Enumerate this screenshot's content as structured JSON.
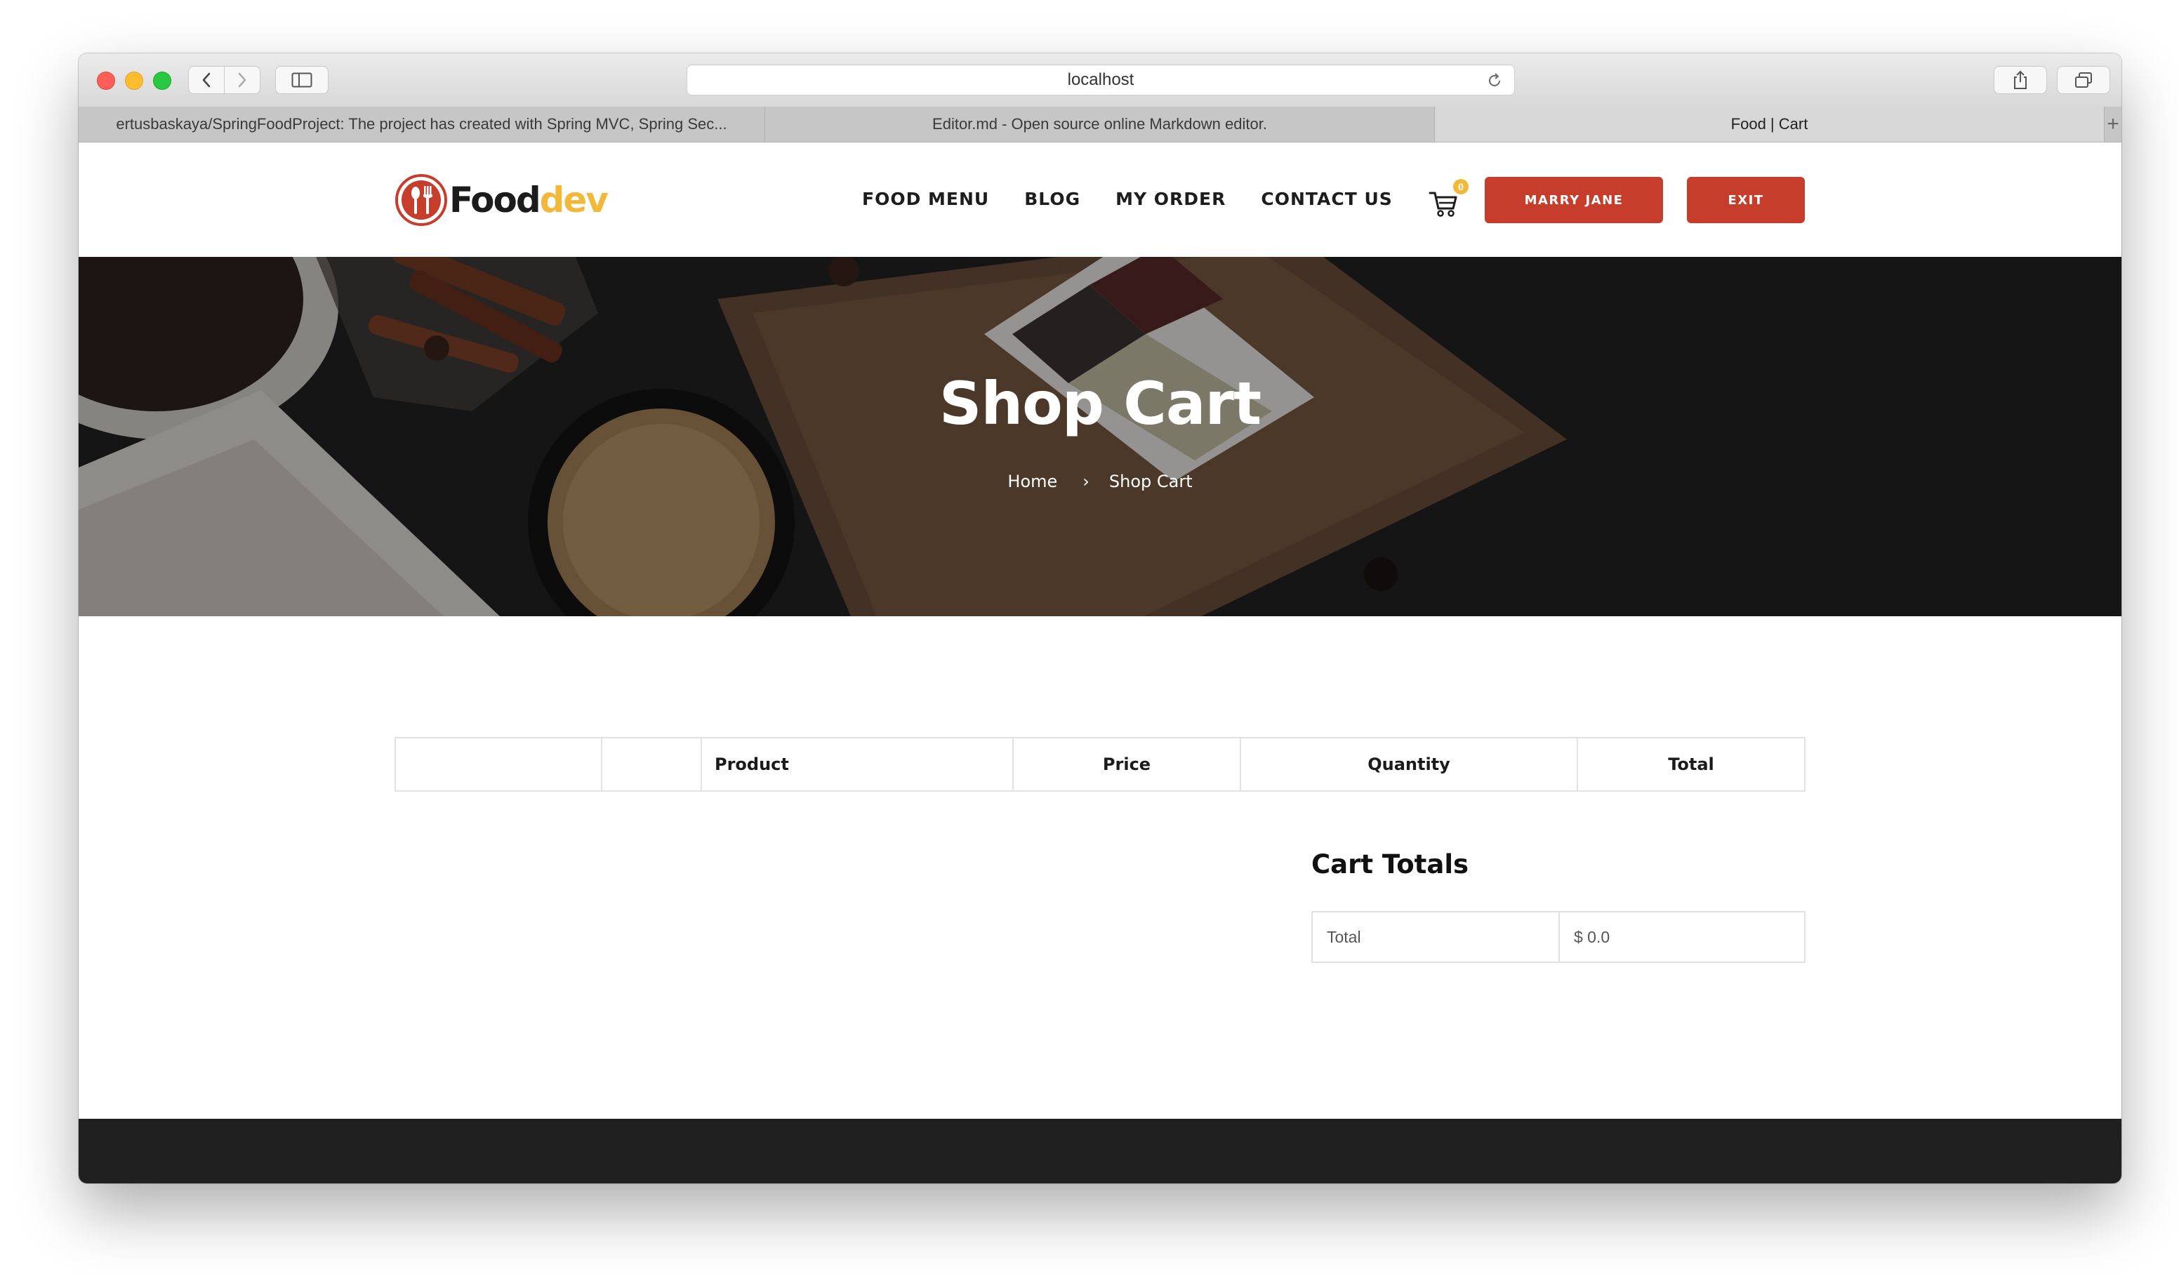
{
  "browser": {
    "url": "localhost",
    "tabs": [
      {
        "title": "ertusbaskaya/SpringFoodProject: The project has created with Spring MVC, Spring Sec..."
      },
      {
        "title": "Editor.md - Open source online Markdown editor."
      },
      {
        "title": "Food | Cart"
      }
    ],
    "active_tab": "Food | Cart"
  },
  "header": {
    "logo_food": "Food",
    "logo_dev": "dev",
    "nav": [
      {
        "label": "FOOD MENU"
      },
      {
        "label": "BLOG"
      },
      {
        "label": "MY ORDER"
      },
      {
        "label": "CONTACT US"
      }
    ],
    "cart_count": "0",
    "user_button": "MARRY JANE",
    "exit_button": "EXIT"
  },
  "hero": {
    "title": "Shop Cart",
    "breadcrumb": [
      "Home",
      "Shop Cart"
    ]
  },
  "cart_table": {
    "columns": [
      "",
      "",
      "Product",
      "Price",
      "Quantity",
      "Total"
    ],
    "rows": []
  },
  "cart_totals": {
    "title": "Cart Totals",
    "label": "Total",
    "value": "$ 0.0"
  },
  "colors": {
    "accent": "#c63d2c",
    "logo_yellow": "#f2b83a",
    "footer": "#202020"
  }
}
